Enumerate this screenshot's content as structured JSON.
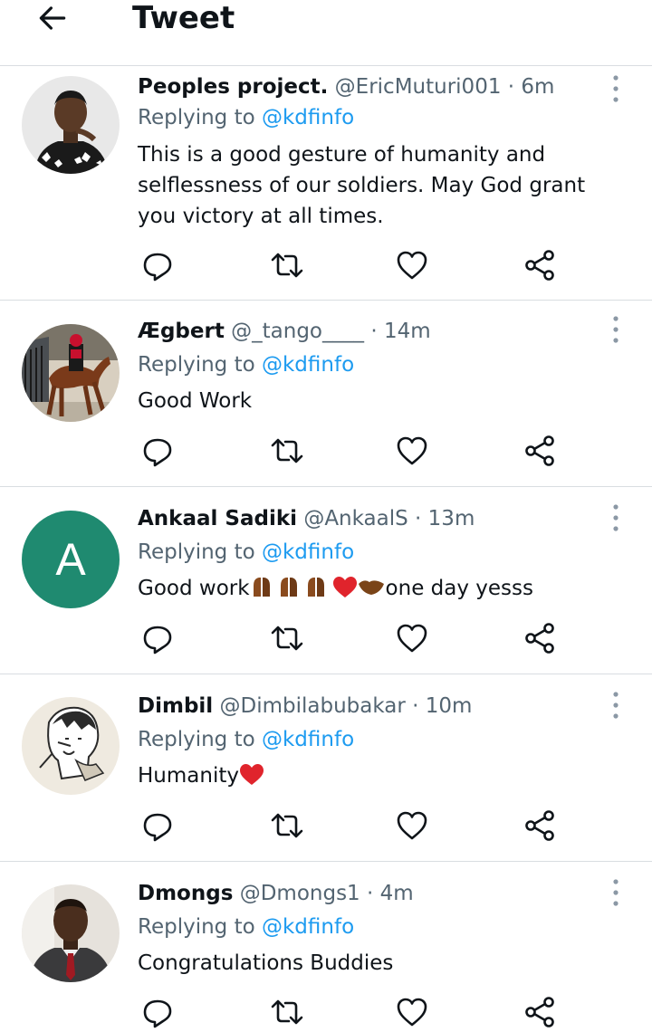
{
  "header": {
    "title": "Tweet",
    "back_icon": "arrow-left-icon"
  },
  "tweets": [
    {
      "name": "Peoples project.",
      "handle": "@EricMuturi001",
      "time": "6m",
      "replying_prefix": "Replying to",
      "replying_handle": "@kdfinfo",
      "text": "This is a good gesture of humanity and selflessness of our soldiers. May God grant you victory at all times."
    },
    {
      "name": "Ægbert",
      "handle": "@_tango____",
      "time": "14m",
      "replying_prefix": "Replying to",
      "replying_handle": "@kdfinfo",
      "text": "Good Work"
    },
    {
      "name": "Ankaal Sadiki",
      "handle": "@AnkaalS",
      "time": "13m",
      "replying_prefix": "Replying to",
      "replying_handle": "@kdfinfo",
      "avatar_letter": "A",
      "text_before": "Good work",
      "text_after": "one day yesss"
    },
    {
      "name": "Dimbil",
      "handle": "@Dimbilabubakar",
      "time": "10m",
      "replying_prefix": "Replying to",
      "replying_handle": "@kdfinfo",
      "text_before": "Humanity"
    },
    {
      "name": "Dmongs",
      "handle": "@Dmongs1",
      "time": "4m",
      "replying_prefix": "Replying to",
      "replying_handle": "@kdfinfo",
      "text": "Congratulations Buddies"
    }
  ],
  "icons": {
    "reply": "reply-icon",
    "retweet": "retweet-icon",
    "like": "heart-icon",
    "share": "share-icon",
    "more": "more-vertical-icon"
  },
  "colors": {
    "link": "#1d9bf0",
    "secondary_text": "#536471",
    "avatar_A": "#1f8a70",
    "heart_emoji": "#e0242c"
  }
}
